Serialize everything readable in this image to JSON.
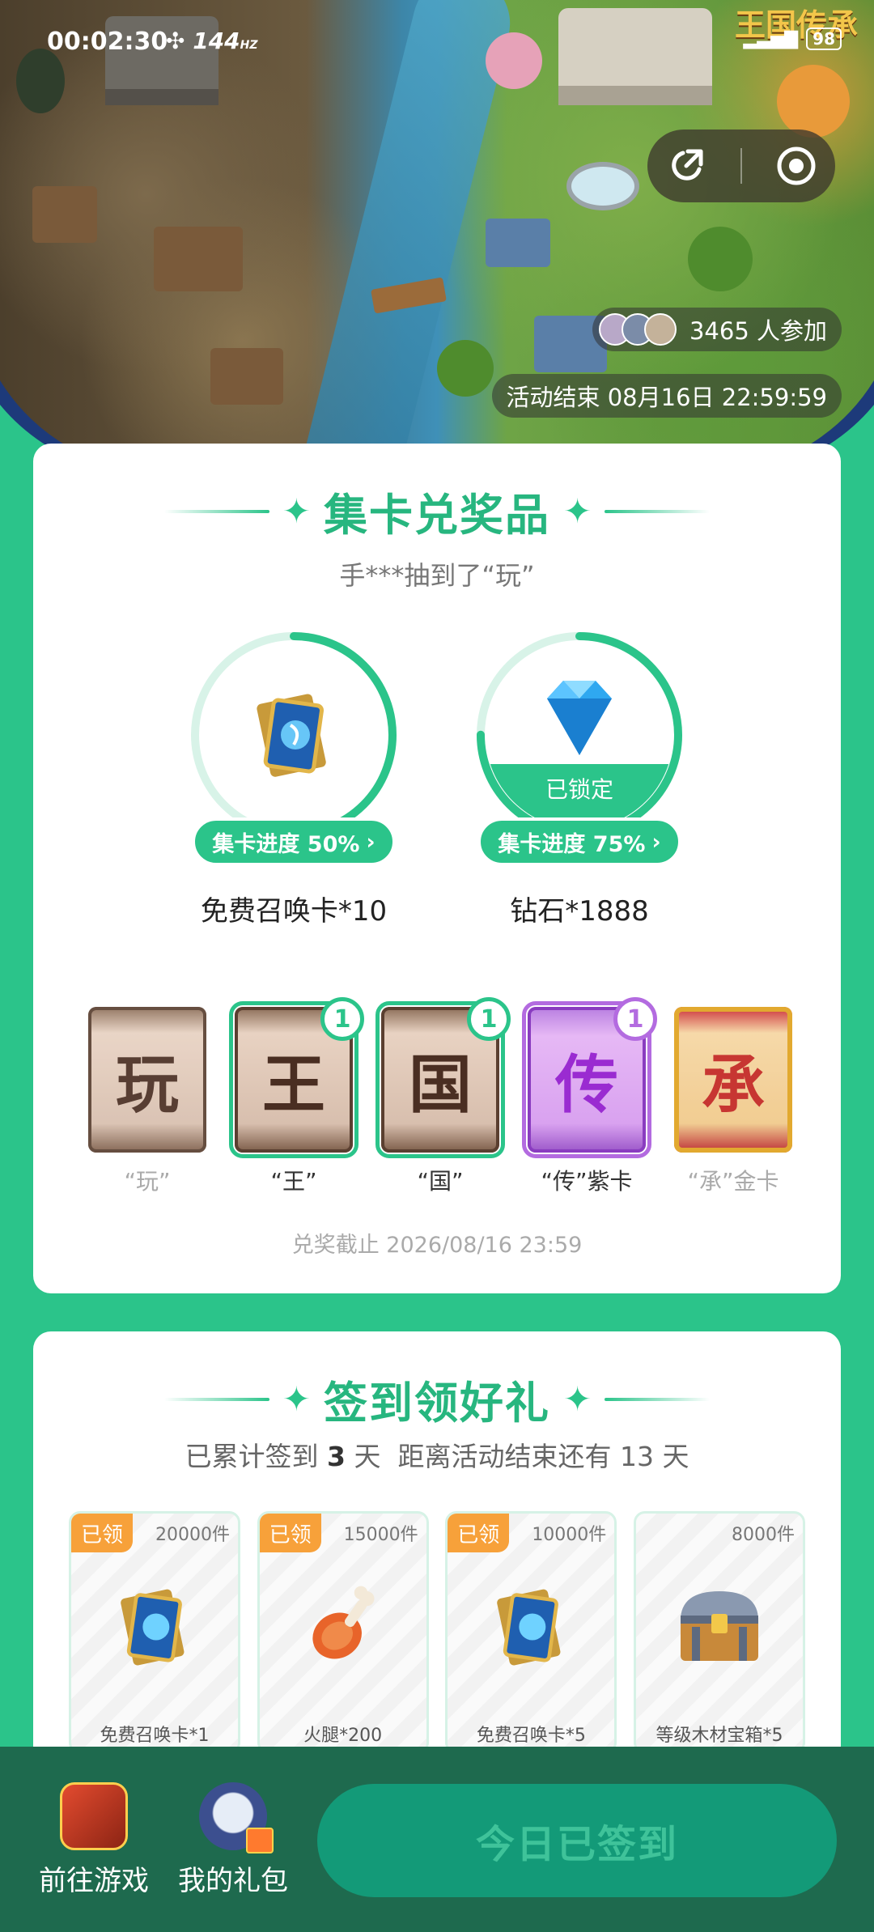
{
  "status_bar": {
    "time": "00:02:30",
    "refresh_rate": "144",
    "refresh_unit": "HZ",
    "battery": "98"
  },
  "hero": {
    "game_logo": "王国传承",
    "participants": "3465 人参加",
    "end_time": "活动结束 08月16日 22:59:59"
  },
  "collect_section": {
    "title": "集卡兑奖品",
    "lottery_message": "手***抽到了“玩”",
    "prizes": [
      {
        "name": "免费召唤卡*10",
        "progress_label": "集卡进度 50%",
        "progress": 0.5,
        "locked": false
      },
      {
        "name": "钻石*1888",
        "progress_label": "集卡进度 75%",
        "progress": 0.75,
        "locked": true,
        "locked_label": "已锁定"
      }
    ],
    "cards": [
      {
        "glyph": "玩",
        "label": "“玩”",
        "count": null,
        "style": "brown"
      },
      {
        "glyph": "王",
        "label": "“王”",
        "count": "1",
        "style": "brown"
      },
      {
        "glyph": "国",
        "label": "“国”",
        "count": "1",
        "style": "brown"
      },
      {
        "glyph": "传",
        "label": "“传”紫卡",
        "count": "1",
        "style": "purple"
      },
      {
        "glyph": "承",
        "label": "“承”金卡",
        "count": null,
        "style": "gold"
      }
    ],
    "deadline": "兑奖截止 2026/08/16 23:59"
  },
  "signin_section": {
    "title": "签到领好礼",
    "prefix": "已累计签到",
    "days": "3",
    "suffix": "天  距离活动结束还有 13 天",
    "rewards": [
      {
        "claimed": "已领",
        "qty": "20000件",
        "name": "免费召唤卡*1",
        "icon": "summon-card-icon"
      },
      {
        "claimed": "已领",
        "qty": "15000件",
        "name": "火腿*200",
        "icon": "ham-icon"
      },
      {
        "claimed": "已领",
        "qty": "10000件",
        "name": "免费召唤卡*5",
        "icon": "summon-card-icon"
      },
      {
        "claimed": "",
        "qty": "8000件",
        "name": "等级木材宝箱*5",
        "icon": "chest-icon"
      }
    ]
  },
  "bottom_bar": {
    "go_game": "前往游戏",
    "my_gifts": "我的礼包",
    "signed_today": "今日已签到"
  },
  "colors": {
    "accent": "#2bc48a",
    "bottom_bar": "#1e6a4e",
    "claimed_tag": "#f7a13a",
    "purple_card": "#b36be0"
  }
}
